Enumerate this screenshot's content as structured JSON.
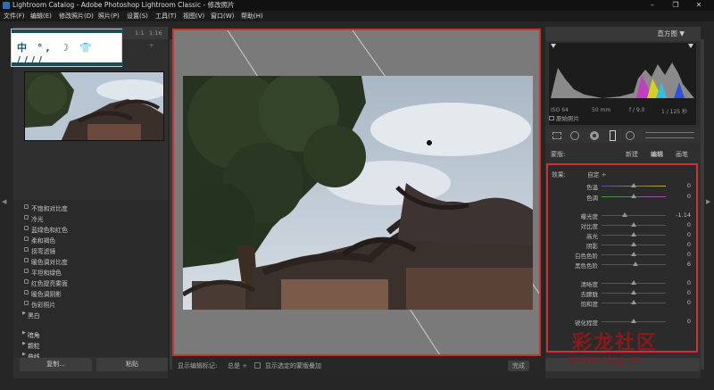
{
  "window": {
    "title": "Lightroom Catalog - Adobe Photoshop Lightroom Classic - 修改照片",
    "controls": [
      "–",
      "❐",
      "✕"
    ]
  },
  "menu": [
    "文件(F)",
    "编辑(E)",
    "修改照片(D)",
    "照片(P)",
    "设置(S)",
    "工具(T)",
    "视图(V)",
    "窗口(W)",
    "帮助(H)"
  ],
  "navigator": {
    "zoom_fit": "1:1",
    "zoom_level": "1:16 ÷"
  },
  "watermark_logo": {
    "chars": "中 °, ☽ 👕 ////"
  },
  "presets": {
    "items": [
      "不饱和对比度",
      "冷光",
      "蓝绿色和红色",
      "柔和褐色",
      "拐弯滤镜",
      "暖色调对比度",
      "平坦和绿色",
      "红色提亮雾面",
      "暖色调阴影",
      "伪彩照片"
    ],
    "folders": [
      "黑白",
      "暗角",
      "颗粒",
      "曲线"
    ]
  },
  "left_buttons": {
    "copy": "复制...",
    "paste": "粘贴"
  },
  "toolbar": {
    "label": "显示编辑标记:",
    "mode": "总是 ÷",
    "overlay": "显示选定的蒙版叠加",
    "done": "完成"
  },
  "right": {
    "histogram_title": "直方图 ▼",
    "exif": {
      "iso": "ISO 64",
      "focal": "50 mm",
      "aperture": "f / 9.0",
      "shutter": "1 / 125 秒"
    },
    "original_photo": "原始照片",
    "mask": {
      "label": "蒙版:",
      "new": "新建",
      "edit": "编辑",
      "reset": "画笔"
    },
    "effect": {
      "label": "效果:",
      "value": "自定 ÷"
    },
    "sliders": [
      {
        "label": "色温",
        "value": "0",
        "pos": 0.5
      },
      {
        "label": "色调",
        "value": "0",
        "pos": 0.5
      },
      {
        "label": "曝光度",
        "value": "-1.14",
        "pos": 0.36
      },
      {
        "label": "对比度",
        "value": "0",
        "pos": 0.5
      },
      {
        "label": "高光",
        "value": "0",
        "pos": 0.5
      },
      {
        "label": "阴影",
        "value": "0",
        "pos": 0.5
      },
      {
        "label": "白色色阶",
        "value": "0",
        "pos": 0.5
      },
      {
        "label": "黑色色阶",
        "value": "6",
        "pos": 0.53
      },
      {
        "label": "清晰度",
        "value": "0",
        "pos": 0.5
      },
      {
        "label": "去朦胧",
        "value": "0",
        "pos": 0.5
      },
      {
        "label": "饱和度",
        "value": "0",
        "pos": 0.5
      },
      {
        "label": "锐化程度",
        "value": "0",
        "pos": 0.5
      }
    ]
  },
  "watermark_site": {
    "text": "彩龙社区",
    "url": "www.clzg.cn"
  },
  "colors": {
    "highlight_border": "#d03030",
    "panel_bg": "#2f2f2f"
  }
}
